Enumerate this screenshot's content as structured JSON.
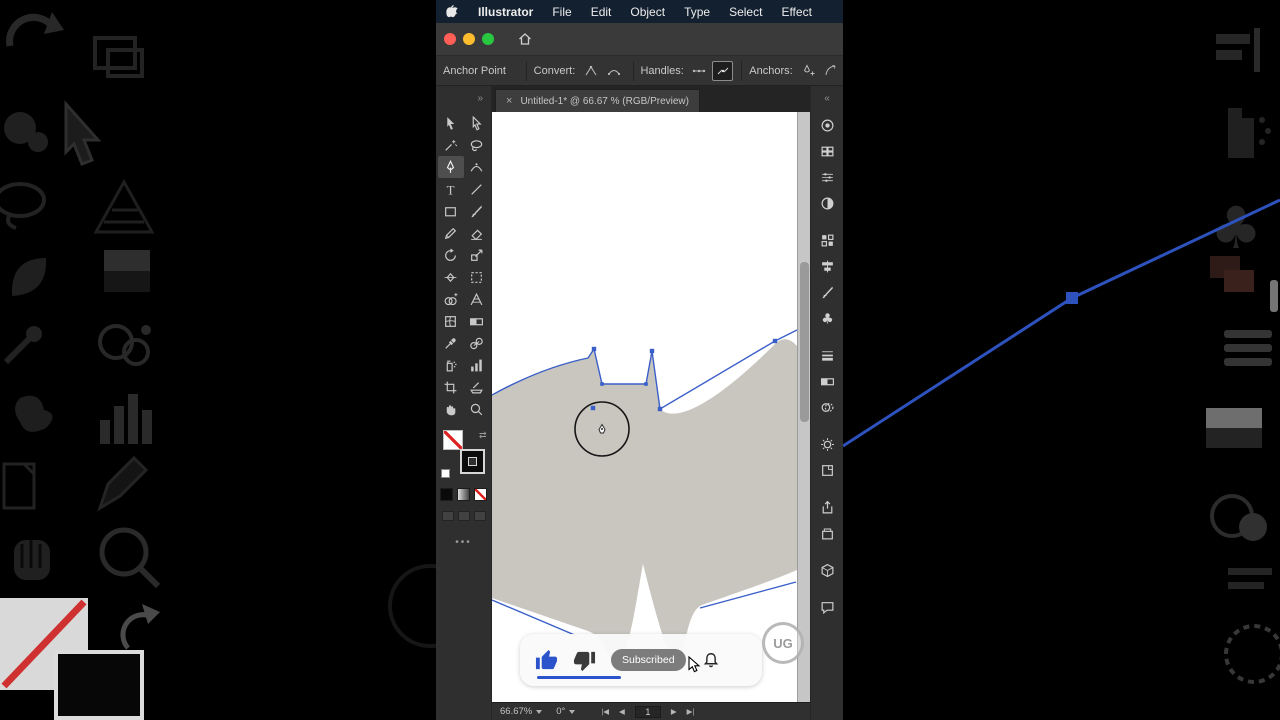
{
  "app": {
    "name": "Illustrator"
  },
  "menubar": {
    "items": [
      "File",
      "Edit",
      "Object",
      "Type",
      "Select",
      "Effect"
    ]
  },
  "window_controls": {
    "colors": [
      "#ff5f57",
      "#febc2e",
      "#28c840"
    ]
  },
  "control_bar": {
    "title": "Anchor Point",
    "groups": [
      {
        "label": "Convert:",
        "buttons": [
          {
            "icon": "convert-corner-icon",
            "selected": false
          },
          {
            "icon": "convert-smooth-icon",
            "selected": false
          }
        ]
      },
      {
        "label": "Handles:",
        "buttons": [
          {
            "icon": "handles-show-icon",
            "selected": false
          },
          {
            "icon": "handles-hide-icon",
            "selected": true
          }
        ]
      },
      {
        "label": "Anchors:",
        "buttons": [
          {
            "icon": "anchor-add-icon",
            "selected": false
          },
          {
            "icon": "anchor-arc-icon",
            "selected": false
          }
        ]
      }
    ]
  },
  "document_tab": {
    "close_glyph": "×",
    "title": "Untitled-1* @ 66.67 % (RGB/Preview)"
  },
  "toolbar": {
    "expand_glyph": "»",
    "tools": [
      {
        "name": "selection-tool",
        "icon": "arrow-filled"
      },
      {
        "name": "direct-selection-tool",
        "icon": "arrow-outline"
      },
      {
        "name": "magic-wand-tool",
        "icon": "wand"
      },
      {
        "name": "lasso-tool",
        "icon": "lasso"
      },
      {
        "name": "pen-tool",
        "icon": "pen",
        "active": true
      },
      {
        "name": "curvature-tool",
        "icon": "curvature"
      },
      {
        "name": "type-tool",
        "icon": "type"
      },
      {
        "name": "line-segment-tool",
        "icon": "line"
      },
      {
        "name": "rectangle-tool",
        "icon": "rect"
      },
      {
        "name": "paintbrush-tool",
        "icon": "brush"
      },
      {
        "name": "pencil-tool",
        "icon": "pencil"
      },
      {
        "name": "eraser-tool",
        "icon": "eraser"
      },
      {
        "name": "rotate-tool",
        "icon": "rotate"
      },
      {
        "name": "scale-tool",
        "icon": "scale"
      },
      {
        "name": "width-tool",
        "icon": "width"
      },
      {
        "name": "free-transform-tool",
        "icon": "freetransform"
      },
      {
        "name": "shape-builder-tool",
        "icon": "shapebuilder"
      },
      {
        "name": "perspective-grid-tool",
        "icon": "perspective"
      },
      {
        "name": "mesh-tool",
        "icon": "mesh"
      },
      {
        "name": "gradient-tool",
        "icon": "gradient"
      },
      {
        "name": "eyedropper-tool",
        "icon": "eyedropper"
      },
      {
        "name": "blend-tool",
        "icon": "blend"
      },
      {
        "name": "symbol-sprayer-tool",
        "icon": "sprayer"
      },
      {
        "name": "column-graph-tool",
        "icon": "graph"
      },
      {
        "name": "artboard-tool",
        "icon": "artboard"
      },
      {
        "name": "slice-tool",
        "icon": "slice"
      },
      {
        "name": "hand-tool",
        "icon": "hand"
      },
      {
        "name": "zoom-tool",
        "icon": "zoom"
      }
    ]
  },
  "right_panel": {
    "collapse_glyph": "«",
    "icons": [
      "color-icon",
      "swatches-icon",
      "color-guide-icon",
      "gradient-icon",
      "symbols-icon",
      "align-icon",
      "brushes-icon",
      "shapes-icon",
      "stroke-icon",
      "gradient-panel-icon",
      "transparency-icon",
      "appearance-icon",
      "graphic-styles-icon",
      "asset-export-icon",
      "libraries-icon",
      "3d-icon",
      "comments-icon"
    ]
  },
  "status_bar": {
    "zoom": "66.67%",
    "rotation": "0°",
    "page": "1",
    "nav_glyphs": [
      "|◀",
      "◀",
      "▶",
      "▶|"
    ],
    "nav_names": [
      "first-page-icon",
      "previous-page-icon",
      "next-page-icon",
      "last-page-icon"
    ]
  },
  "overlay": {
    "subscribed_label": "Subscribed",
    "watermark": "UG"
  },
  "colors": {
    "accent_blue": "#2a53cc",
    "path_blue": "#3a5fc8",
    "shape_gray": "#c9c6c0",
    "canvas_white": "#ffffff"
  }
}
